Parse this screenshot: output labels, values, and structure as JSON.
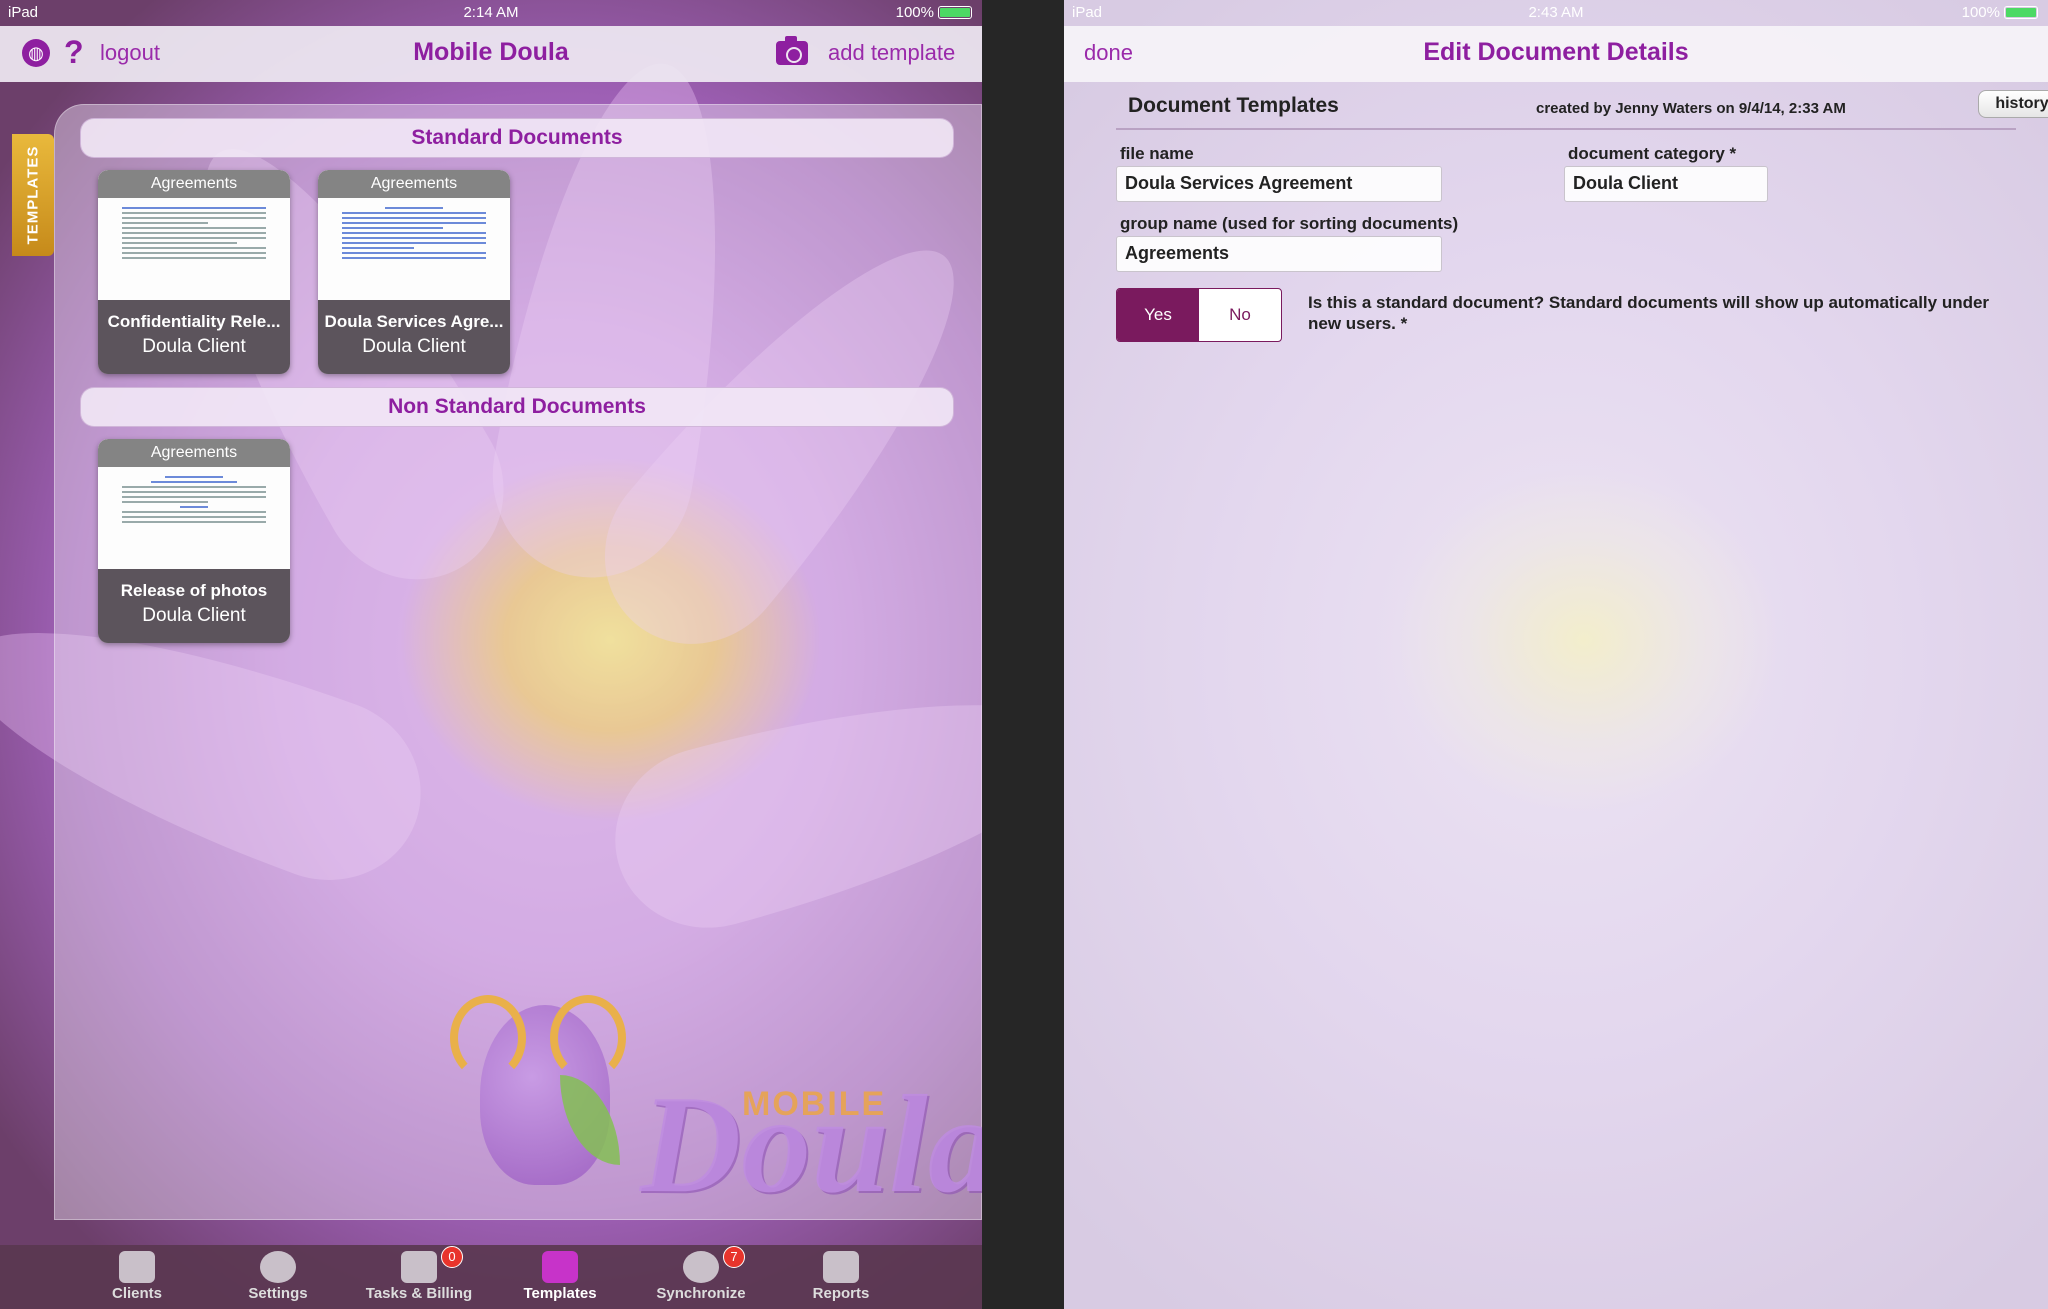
{
  "left": {
    "status": {
      "device": "iPad",
      "time": "2:14 AM",
      "battery": "100%"
    },
    "nav": {
      "logout": "logout",
      "title": "Mobile Doula",
      "add_template": "add template"
    },
    "side_tab": "TEMPLATES",
    "sections": {
      "standard": "Standard Documents",
      "non_standard": "Non Standard Documents"
    },
    "cards": [
      {
        "group": "Agreements",
        "title": "Confidentiality Rele...",
        "subtitle": "Doula Client"
      },
      {
        "group": "Agreements",
        "title": "Doula Services Agre...",
        "subtitle": "Doula Client"
      },
      {
        "group": "Agreements",
        "title": "Release of photos",
        "subtitle": "Doula Client"
      }
    ],
    "logo": {
      "mobile": "MOBILE",
      "doula": "Doula"
    },
    "tabs": [
      {
        "label": "Clients",
        "icon": "clients-icon"
      },
      {
        "label": "Settings",
        "icon": "gear-icon"
      },
      {
        "label": "Tasks & Billing",
        "icon": "tasks-billing-icon",
        "badge": "0"
      },
      {
        "label": "Templates",
        "icon": "inbox-tray-icon"
      },
      {
        "label": "Synchronize",
        "icon": "sync-icon",
        "badge": "7"
      },
      {
        "label": "Reports",
        "icon": "reports-icon"
      }
    ],
    "colors": {
      "accent": "#8e1fa0",
      "active_tab": "#c733c9",
      "badge": "#e8342c"
    }
  },
  "right": {
    "status": {
      "device": "iPad",
      "time": "2:43 AM",
      "battery": "100%"
    },
    "nav": {
      "done": "done",
      "title": "Edit Document Details"
    },
    "section_title": "Document Templates",
    "created": "created by Jenny Waters on 9/4/14, 2:33 AM",
    "history": "history",
    "fields": {
      "file_name": {
        "label": "file name",
        "value": "Doula Services Agreement"
      },
      "category": {
        "label": "document category *",
        "value": "Doula Client"
      },
      "group": {
        "label": "group name (used for sorting documents)",
        "value": "Agreements"
      }
    },
    "toggle": {
      "yes": "Yes",
      "no": "No",
      "selected": "Yes"
    },
    "question": "Is this a standard document?  Standard documents will show up automatically under new users. *",
    "colors": {
      "toggle_selected": "#7a1a5e"
    }
  }
}
